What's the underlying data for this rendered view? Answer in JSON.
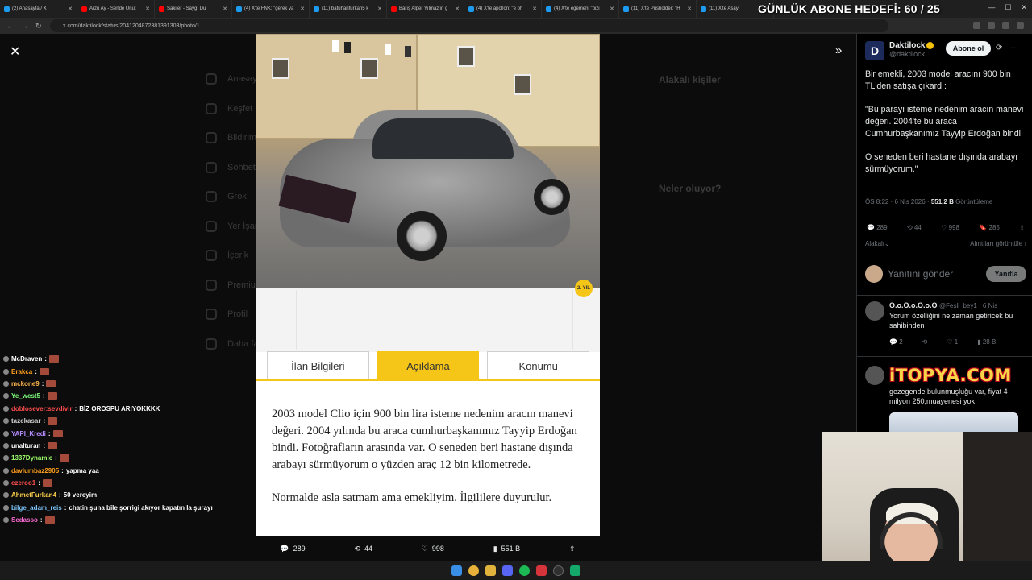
{
  "browser": {
    "tabs": [
      {
        "label": "(2) Anasayfa / X",
        "color": "#1d9bf0"
      },
      {
        "label": "Arzu Ay - Sende Unut",
        "color": "#ff0000"
      },
      {
        "label": "Sakiler - Saygı Du",
        "color": "#ff0000"
      },
      {
        "label": "(4) X'te FNK: \"gerek va",
        "color": "#1d9bf0"
      },
      {
        "label": "(11) batuhanfurkan5 k",
        "color": "#1d9bf0"
      },
      {
        "label": "Barış Alper Yılmaz'ın g",
        "color": "#ff0000"
      },
      {
        "label": "(4) X'te apollon: \"e oh",
        "color": "#1d9bf0"
      },
      {
        "label": "(4) X'te egemeni \"bizi",
        "color": "#1d9bf0"
      },
      {
        "label": "(11) X'te Pusholder: \"H",
        "color": "#1d9bf0"
      },
      {
        "label": "(11) X'te Asayi",
        "color": "#1d9bf0"
      }
    ],
    "url": "x.com/daktilock/status/2041204872381391303/photo/1"
  },
  "overlay": {
    "goal_text": "GÜNLÜK ABONE HEDEFİ: 60 / 25"
  },
  "background_nav": [
    "Anasayfa",
    "Keşfet",
    "Bildirimler",
    "Sohbet",
    "Grok",
    "Yer İşaretleri",
    "İçerik",
    "Premium",
    "Profil",
    "Daha fazla"
  ],
  "background_right": {
    "related_title": "Alakalı kişiler",
    "trending_title": "Neler oluyor?"
  },
  "photo": {
    "badge": "2. YIL",
    "tabs": [
      "İlan Bilgileri",
      "Açıklama",
      "Konumu"
    ],
    "active_tab": "Açıklama",
    "paragraphs": [
      "2003 model Clio için 900 bin lira isteme nedenim aracın manevi değeri. 2004 yılında bu araca cumhurbaşkanımız Tayyip Erdoğan bindi. Fotoğrafların arasında var. O seneden beri hastane dışında arabayı sürmüyorum o yüzden araç 12 bin kilometrede.",
      "Normalde asla satmam ama emekliyim. İlgililere duyurulur."
    ]
  },
  "photo_actions": {
    "replies": "289",
    "reposts": "44",
    "likes": "998",
    "views": "551 B"
  },
  "tweet": {
    "avatar_letter": "D",
    "name": "Daktilock",
    "handle": "@daktilock",
    "subscribe_label": "Abone ol",
    "paragraphs": [
      "Bir emekli, 2003 model aracını 900 bin TL'den satışa çıkardı:",
      "\"Bu parayı isteme nedenim aracın manevi değeri. 2004'te bu araca Cumhurbaşkanımız Tayyip Erdoğan bindi.",
      "O seneden beri hastane dışında arabayı sürmüyorum.\""
    ],
    "time": "ÖS 8:22 · 6 Nis 2026 · ",
    "views": "551,2 B",
    "views_label": " Görüntüleme",
    "stats": {
      "replies": "289",
      "reposts": "44",
      "likes": "998",
      "bookmarks": "285"
    },
    "related_label": "Alakalı",
    "show_quotes": "Alıntıları görüntüle",
    "reply_placeholder": "Yanıtını gönder",
    "reply_button": "Yanıtla"
  },
  "reply1": {
    "name": "O.o.O.o.O.o.O",
    "handle": "@Fesli_bey1 · 6 Nis",
    "text": "Yorum özelliğini ne zaman getiricek bu sahibinden",
    "replies": "2",
    "likes": "1",
    "views": "28 B"
  },
  "reply2": {
    "watermark": "iTOPYA.COM",
    "text": "gezegende bulunmuşluğu var, fiyat 4 milyon 250,muayenesi yok"
  },
  "chat": [
    {
      "user": "McDraven",
      "color": "#ffffff",
      "msg": ""
    },
    {
      "user": "Erakca",
      "color": "#ff9f1c",
      "msg": ""
    },
    {
      "user": "mckone9",
      "color": "#ffb84d",
      "msg": ""
    },
    {
      "user": "Ye_west5",
      "color": "#7fff7f",
      "msg": ""
    },
    {
      "user": "doblosever:sevdivir",
      "color": "#ff4d4d",
      "msg": "BİZ OROSPU ARIYOKKKK"
    },
    {
      "user": "tazekasar",
      "color": "#cfcfcf",
      "msg": ""
    },
    {
      "user": "YAPI_Kredi",
      "color": "#b58cff",
      "msg": ""
    },
    {
      "user": "unalturan",
      "color": "#ffffff",
      "msg": ""
    },
    {
      "user": "1337Dynamic",
      "color": "#9cff6b",
      "msg": ""
    },
    {
      "user": "davlumbaz2905",
      "color": "#ff9f1c",
      "msg": "yapma yaa"
    },
    {
      "user": "ezeroo1",
      "color": "#ff4d4d",
      "msg": ""
    },
    {
      "user": "AhmetFurkan4",
      "color": "#ffd24d",
      "msg": "50 vereyim"
    },
    {
      "user": "bilge_adam_reis",
      "color": "#7ec8ff",
      "msg": "chatin şuna bile şorrigi akıyor kapatın la şurayı"
    },
    {
      "user": "Sedasso",
      "color": "#ff6bd6",
      "msg": ""
    }
  ]
}
